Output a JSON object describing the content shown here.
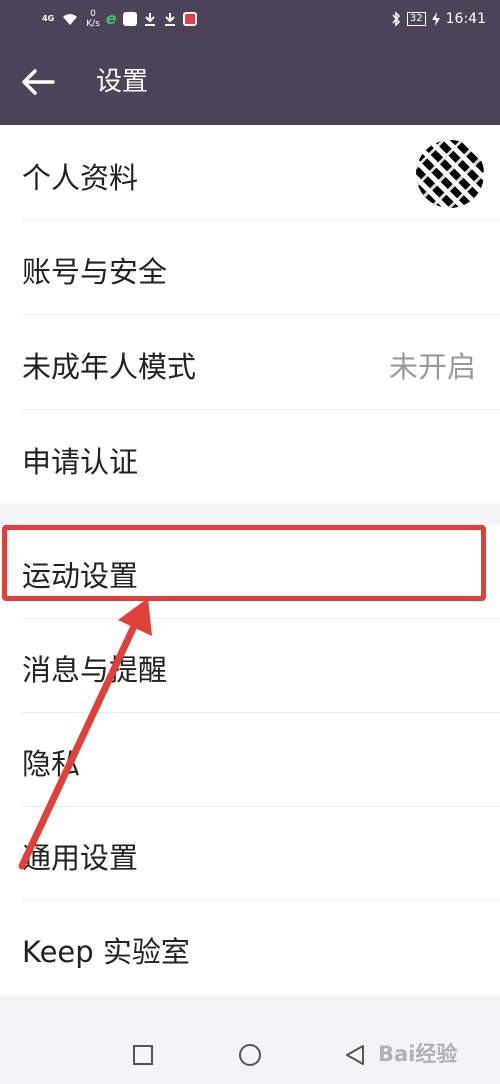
{
  "status_bar": {
    "network": "4G",
    "speed_value": "0",
    "speed_unit": "K/s",
    "battery": "32",
    "time": "16:41"
  },
  "header": {
    "title": "设置",
    "back_icon": "arrow-left-icon"
  },
  "settings": {
    "profile": "个人资料",
    "account": "账号与安全",
    "minor_mode": "未成年人模式",
    "minor_mode_status": "未开启",
    "verify": "申请认证",
    "sport": "运动设置",
    "message": "消息与提醒",
    "privacy": "隐私",
    "general": "通用设置",
    "lab": "Keep 实验室"
  },
  "annotation": {
    "highlight_color": "#e0403a"
  },
  "nav_bar": {
    "icons": [
      "square-recents-icon",
      "circle-home-icon",
      "triangle-back-icon"
    ]
  },
  "watermark": "Bai经验"
}
